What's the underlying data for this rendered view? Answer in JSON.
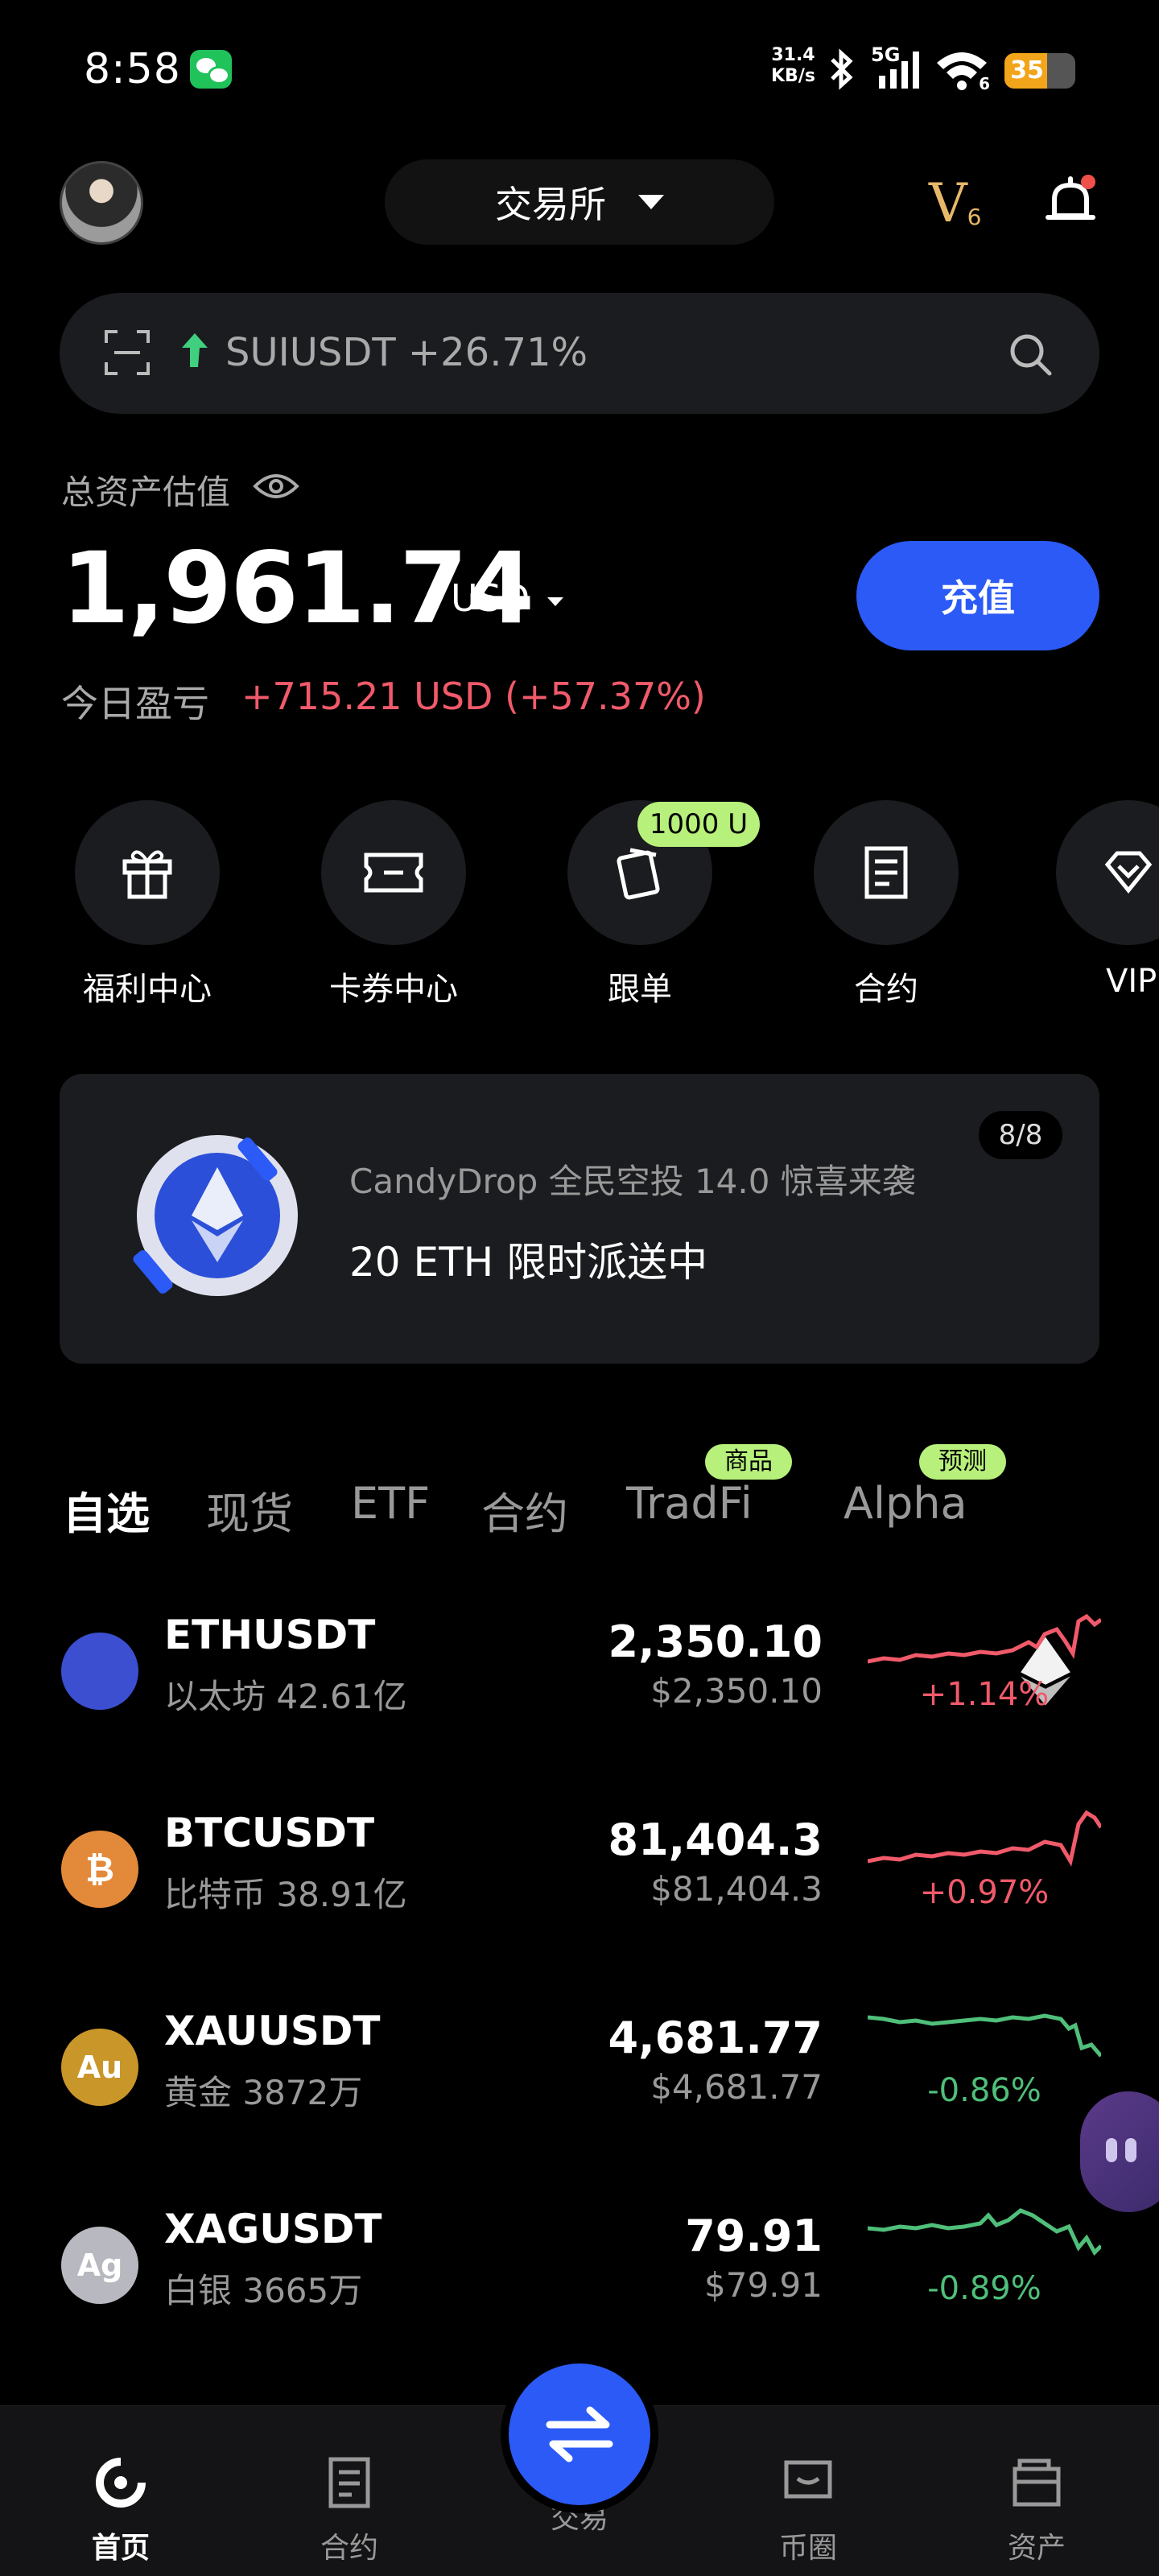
{
  "status_bar": {
    "time": "8:58",
    "net_speed": "31.4",
    "net_unit": "KB/s",
    "network_type": "5G",
    "wifi_level": "6",
    "battery": "35"
  },
  "header": {
    "exchange_selector": "交易所",
    "vip_level": "V",
    "vip_sub": "6"
  },
  "search": {
    "trending_symbol": "SUIUSDT",
    "trending_change": "+26.71%"
  },
  "assets": {
    "label": "总资产估值",
    "total": "1,961.74",
    "currency": "USD",
    "deposit_label": "充值",
    "pnl_label": "今日盈亏",
    "pnl_value": "+715.21 USD (+57.37%)"
  },
  "quick_actions": [
    {
      "label": "福利中心",
      "icon": "gift-icon"
    },
    {
      "label": "卡券中心",
      "icon": "ticket-icon"
    },
    {
      "label": "跟单",
      "icon": "copy-trade-icon",
      "badge": "1000 U"
    },
    {
      "label": "合约",
      "icon": "contract-icon"
    },
    {
      "label": "VIP",
      "icon": "vip-diamond-icon"
    }
  ],
  "banner": {
    "subtitle": "CandyDrop 全民空投 14.0 惊喜来袭",
    "title": "20 ETH 限时派送中",
    "counter": "8/8"
  },
  "tabs": [
    {
      "label": "自选",
      "active": true
    },
    {
      "label": "现货"
    },
    {
      "label": "ETF"
    },
    {
      "label": "合约"
    },
    {
      "label": "TradFi",
      "tag": "商品"
    },
    {
      "label": "Alpha",
      "tag": "预测"
    }
  ],
  "market": [
    {
      "symbol": "ETHUSDT",
      "name": "以太坊 42.61亿",
      "price": "2,350.10",
      "usd": "$2,350.10",
      "change": "+1.14%",
      "icon_text": "",
      "icon": "eth-icon",
      "color": "#f05a6a"
    },
    {
      "symbol": "BTCUSDT",
      "name": "比特币 38.91亿",
      "price": "81,404.3",
      "usd": "$81,404.3",
      "change": "+0.97%",
      "icon_text": "₿",
      "icon": "btc-icon",
      "color": "#f05a6a"
    },
    {
      "symbol": "XAUUSDT",
      "name": "黄金 3872万",
      "price": "4,681.77",
      "usd": "$4,681.77",
      "change": "-0.86%",
      "icon_text": "Au",
      "icon": "gold-icon",
      "color": "#4fbf7a"
    },
    {
      "symbol": "XAGUSDT",
      "name": "白银 3665万",
      "price": "79.91",
      "usd": "$79.91",
      "change": "-0.89%",
      "icon_text": "Ag",
      "icon": "silver-icon",
      "color": "#4fbf7a"
    }
  ],
  "nav": [
    {
      "label": "首页",
      "icon": "home-icon",
      "active": true
    },
    {
      "label": "合约",
      "icon": "contract-icon"
    },
    {
      "label": "交易",
      "icon": "swap-icon"
    },
    {
      "label": "币圈",
      "icon": "chat-icon"
    },
    {
      "label": "资产",
      "icon": "wallet-icon"
    }
  ]
}
